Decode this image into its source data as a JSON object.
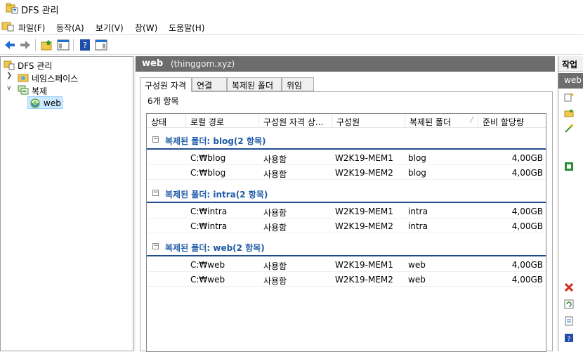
{
  "window": {
    "title": "DFS 관리"
  },
  "menu": {
    "items": [
      "파일(F)",
      "동작(A)",
      "보기(V)",
      "창(W)",
      "도움말(H)"
    ]
  },
  "toolbar": {
    "buttons": [
      "back-icon",
      "forward-icon",
      "up-folder-icon",
      "show-hide-tree-icon",
      "help-icon",
      "action-pane-icon"
    ]
  },
  "tree": {
    "root": "DFS 관리",
    "items": [
      {
        "label": "네임스페이스",
        "expanded": false
      },
      {
        "label": "복제",
        "expanded": true
      },
      {
        "label": "web",
        "selected": true
      }
    ]
  },
  "main": {
    "title": "web",
    "subtitle": "(thinggom.xyz)",
    "tabs": [
      "구성원 자격",
      "연결",
      "복제된 폴더",
      "위임"
    ],
    "active_tab": 0,
    "count_label": "6개 항목",
    "columns": [
      "상태",
      "로컬 경로",
      "구성원 자격 상...",
      "구성원",
      "복제된 폴더",
      "준비 할당량"
    ],
    "groups": [
      {
        "title": "복제된 폴더: blog(2 항목)",
        "rows": [
          {
            "status": "",
            "path": "C:₩blog",
            "membership": "사용함",
            "member": "W2K19-MEM1",
            "folder": "blog",
            "quota": "4,00GB"
          },
          {
            "status": "",
            "path": "C:₩blog",
            "membership": "사용함",
            "member": "W2K19-MEM2",
            "folder": "blog",
            "quota": "4,00GB"
          }
        ]
      },
      {
        "title": "복제된 폴더: intra(2 항목)",
        "rows": [
          {
            "status": "",
            "path": "C:₩intra",
            "membership": "사용함",
            "member": "W2K19-MEM1",
            "folder": "intra",
            "quota": "4,00GB"
          },
          {
            "status": "",
            "path": "C:₩intra",
            "membership": "사용함",
            "member": "W2K19-MEM2",
            "folder": "intra",
            "quota": "4,00GB"
          }
        ]
      },
      {
        "title": "복제된 폴더: web(2 항목)",
        "rows": [
          {
            "status": "",
            "path": "C:₩web",
            "membership": "사용함",
            "member": "W2K19-MEM1",
            "folder": "web",
            "quota": "4,00GB"
          },
          {
            "status": "",
            "path": "C:₩web",
            "membership": "사용함",
            "member": "W2K19-MEM2",
            "folder": "web",
            "quota": "4,00GB"
          }
        ]
      }
    ]
  },
  "actions": {
    "header": "작업",
    "subheader": "web"
  }
}
